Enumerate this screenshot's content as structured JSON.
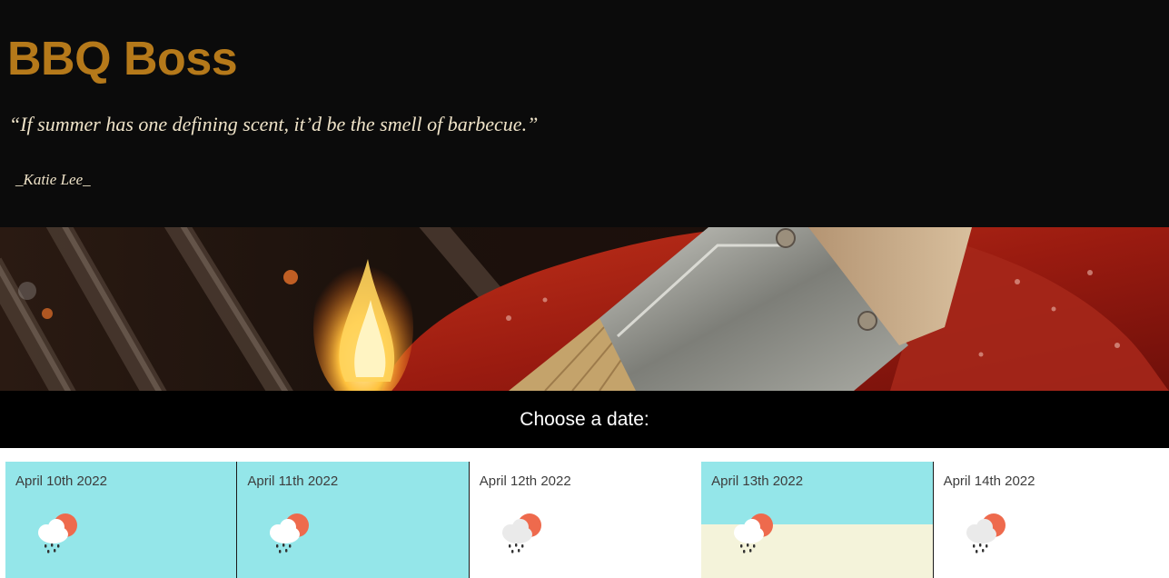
{
  "header": {
    "title": "BBQ Boss",
    "quote": "“If summer has one defining scent, it’d be the smell of barbecue.”",
    "author": "_Katie Lee_"
  },
  "banner": {
    "image": "bbq-grill-ribs-brush-photo"
  },
  "date_picker": {
    "label": "Choose a date:",
    "days": [
      {
        "date": "April 10th 2022",
        "icon": "rain-cloud-sun-icon"
      },
      {
        "date": "April 11th 2022",
        "icon": "rain-cloud-sun-icon"
      },
      {
        "date": "April 12th 2022",
        "icon": "rain-cloud-sun-icon"
      },
      {
        "date": "April 13th 2022",
        "icon": "rain-cloud-sun-icon"
      },
      {
        "date": "April 14th 2022",
        "icon": "rain-cloud-sun-icon"
      }
    ]
  },
  "colors": {
    "title": "#b5791a",
    "header_bg": "#0b0b0b",
    "quote_text": "#efe3c8",
    "card_teal": "#94e6e9",
    "card_cream": "#f4f3da",
    "sun": "#ee6a4d"
  }
}
